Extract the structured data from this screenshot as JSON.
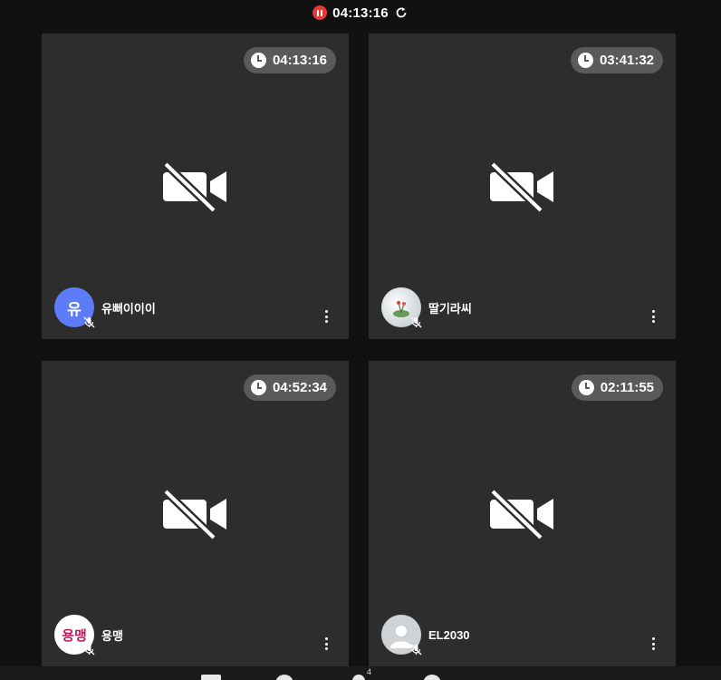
{
  "header": {
    "elapsed": "04:13:16"
  },
  "tiles": [
    {
      "timer": "04:13:16",
      "name": "유뻐이이이",
      "avatar_text": "유",
      "avatar_color": "#5c7cfa"
    },
    {
      "timer": "03:41:32",
      "name": "딸기라씨",
      "avatar_text": "",
      "avatar_color": "#dfe3e6"
    },
    {
      "timer": "04:52:34",
      "name": "용맹",
      "avatar_text": "용맹",
      "avatar_color": "#ffffff"
    },
    {
      "timer": "02:11:55",
      "name": "EL2030",
      "avatar_text": "",
      "avatar_color": "#cfd3d6"
    }
  ],
  "bottom": {
    "participants_count": "4"
  },
  "icons": {
    "record": "pause-record-icon",
    "refresh": "refresh-icon",
    "timer": "clock-icon",
    "camera": "camera-off-icon",
    "mic": "mic-off-icon",
    "menu": "more-vert-icon"
  },
  "colors": {
    "background": "#111111",
    "tile": "#2d2d2d",
    "record": "#e53935",
    "badge": "#5a5a5a"
  }
}
